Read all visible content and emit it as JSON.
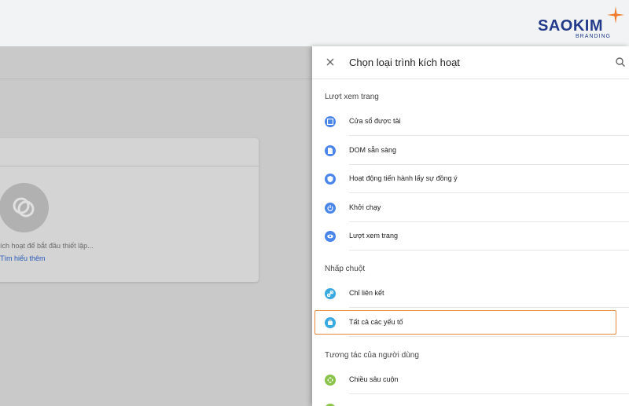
{
  "brand": {
    "name": "SAOKIM",
    "tagline": "BRANDING",
    "accent_color": "#f07b2a",
    "text_color": "#233a8b"
  },
  "background_page": {
    "card_text": "ích hoạt để bắt đầu thiết lập...",
    "card_link": "Tìm hiểu thêm"
  },
  "panel": {
    "title": "Chọn loại trình kích hoạt",
    "close_icon": "close-icon",
    "search_icon": "search-icon",
    "sections": [
      {
        "title": "Lượt xem trang",
        "items": [
          {
            "label": "Cửa sổ được tải",
            "icon": "window-icon",
            "color": "#4a86e8"
          },
          {
            "label": "DOM sẵn sàng",
            "icon": "document-icon",
            "color": "#4a86e8"
          },
          {
            "label": "Hoạt động tiến hành lấy sự đồng ý",
            "icon": "shield-icon",
            "color": "#4a86e8"
          },
          {
            "label": "Khởi chạy",
            "icon": "power-icon",
            "color": "#4a86e8"
          },
          {
            "label": "Lượt xem trang",
            "icon": "eye-icon",
            "color": "#4a86e8"
          }
        ]
      },
      {
        "title": "Nhấp chuột",
        "items": [
          {
            "label": "Chỉ liên kết",
            "icon": "link-icon",
            "color": "#3aa9e0"
          },
          {
            "label": "Tất cả các yếu tố",
            "icon": "cursor-icon",
            "color": "#3aa9e0",
            "selected": true
          }
        ]
      },
      {
        "title": "Tương tác của người dùng",
        "items": [
          {
            "label": "Chiều sâu cuộn",
            "icon": "scroll-icon",
            "color": "#8bc34a"
          }
        ]
      }
    ],
    "selection_color": "#e8893a"
  }
}
